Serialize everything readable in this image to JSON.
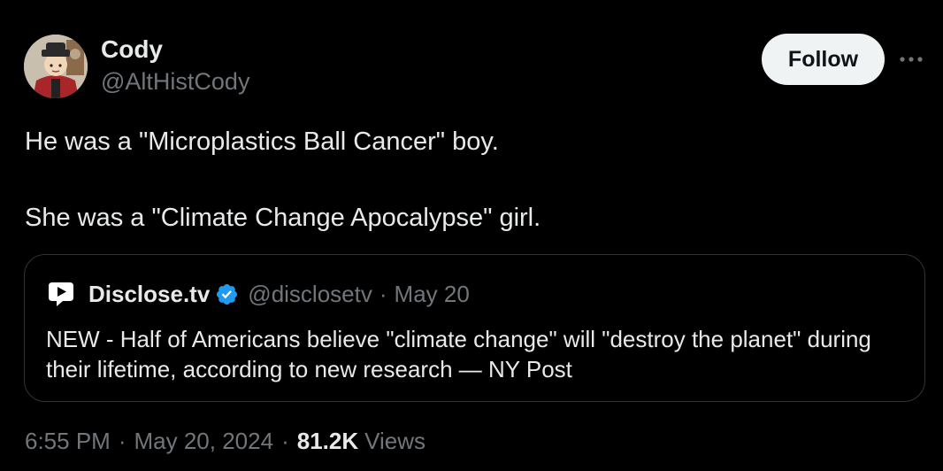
{
  "author": {
    "name": "Cody",
    "handle": "@AltHistCody"
  },
  "actions": {
    "follow_label": "Follow",
    "more_icon": "more-horizontal-icon"
  },
  "tweet": {
    "lines": [
      "He was a \"Microplastics Ball Cancer\" boy.",
      "She was a \"Climate Change Apocalypse\" girl."
    ]
  },
  "quote": {
    "name": "Disclose.tv",
    "verified_icon": "verified-badge-icon",
    "handle": "@disclosetv",
    "separator": "·",
    "date": "May 20",
    "text": "NEW - Half of Americans believe \"climate change\" will \"destroy the planet\" during their lifetime, according to new research — NY Post"
  },
  "meta": {
    "time": "6:55 PM",
    "separator": "·",
    "date": "May 20, 2024",
    "views_count": "81.2K",
    "views_label": "Views"
  },
  "colors": {
    "background": "#000000",
    "text_primary": "#e7e9ea",
    "text_secondary": "#71767b",
    "border": "#2f3336",
    "follow_bg": "#eff3f4",
    "verified": "#1d9bf0"
  }
}
